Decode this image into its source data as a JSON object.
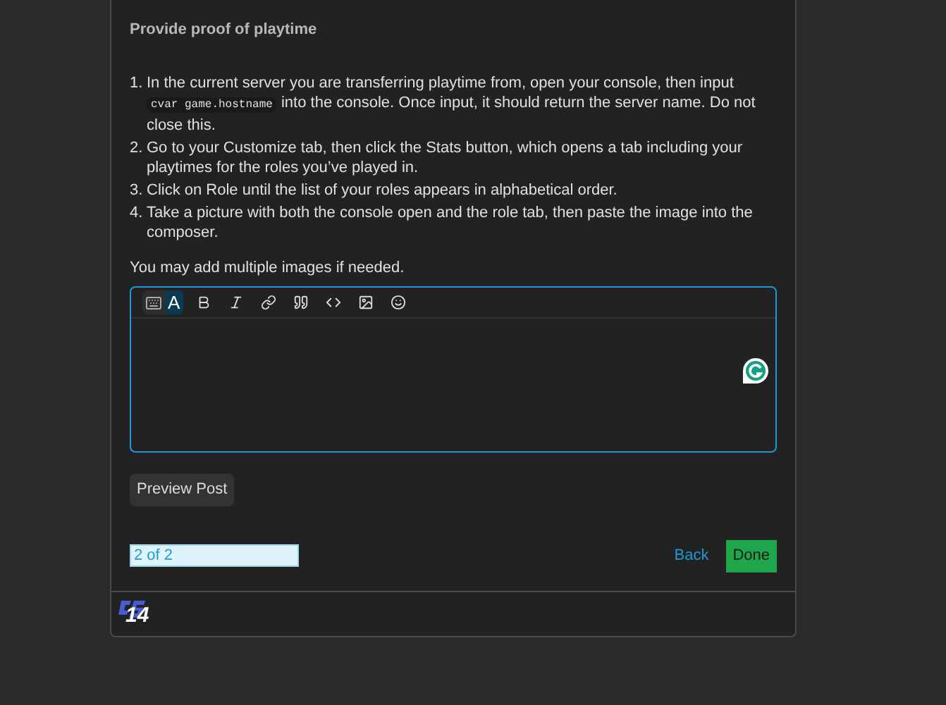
{
  "title": "Provide proof of playtime",
  "steps": [
    {
      "number": "1.",
      "parts": [
        {
          "kind": "text",
          "text": "In the current server you are transferring playtime from, open your console, then input "
        },
        {
          "kind": "code",
          "text": "cvar game.hostname"
        },
        {
          "kind": "text",
          "text": " into the console. Once input, it should return the server name. Do not close this."
        }
      ]
    },
    {
      "number": "2.",
      "parts": [
        {
          "kind": "text",
          "text": "Go to your Customize tab, then click the Stats button, which opens a tab including your playtimes for the roles you’ve played in."
        }
      ]
    },
    {
      "number": "3.",
      "parts": [
        {
          "kind": "text",
          "text": "Click on Role until the list of your roles appears in alphabetical order."
        }
      ]
    },
    {
      "number": "4.",
      "parts": [
        {
          "kind": "text",
          "text": "Take a picture with both the console open and the role tab, then paste the image into the composer."
        }
      ]
    }
  ],
  "note": "You may add multiple images if needed.",
  "mode_toggle": [
    {
      "kind": "markdown",
      "selected": false
    },
    {
      "kind": "rich",
      "label": "A",
      "selected": true
    }
  ],
  "toolbar": [
    {
      "kind": "bold"
    },
    {
      "kind": "italic"
    },
    {
      "kind": "link"
    },
    {
      "kind": "quote"
    },
    {
      "kind": "code"
    },
    {
      "kind": "image"
    },
    {
      "kind": "emoji"
    }
  ],
  "preview_button": "Preview Post",
  "step_counter": "2 of 2",
  "back": "Back",
  "done": "Done",
  "logo": {
    "text": "14"
  }
}
